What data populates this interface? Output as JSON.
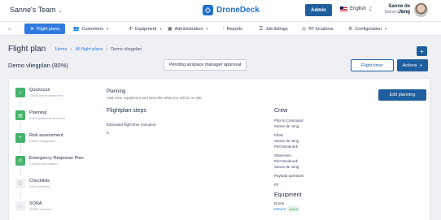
{
  "topbar": {
    "team": "Sanne's Team",
    "brand": "DroneDeck",
    "admin_label": "Admin",
    "language": "English",
    "user_name": "Sanne de Jong",
    "user_team": "Sanne's Team"
  },
  "nav": {
    "items": [
      {
        "label": "Flight plans",
        "icon": "send-icon"
      },
      {
        "label": "Customers",
        "icon": "users-icon"
      },
      {
        "label": "Equipment",
        "icon": "drone-icon"
      },
      {
        "label": "Administration",
        "icon": "briefcase-icon"
      },
      {
        "label": "Reports",
        "icon": "chart-icon"
      },
      {
        "label": "Job listings",
        "icon": "list-icon"
      },
      {
        "label": "RT locations",
        "icon": "target-icon"
      },
      {
        "label": "Configuration",
        "icon": "gear-icon"
      }
    ]
  },
  "header": {
    "title": "Flight plan",
    "breadcrumbs": [
      "Home",
      "All flight plans",
      "Demo vliegplan"
    ],
    "entity_title": "Demo vliegplan (80%)",
    "pending_label": "Pending airspace manager approval",
    "timer_label": "Flight timer",
    "actions_label": "Actions"
  },
  "steps": [
    {
      "title": "Quickscan",
      "subtitle": "Check the environment",
      "done": true
    },
    {
      "title": "Planning",
      "subtitle": "Add equipment and crew",
      "done": true
    },
    {
      "title": "Risk assessment",
      "subtitle": "Define mitigations",
      "done": true
    },
    {
      "title": "Emergency Response Plan",
      "subtitle": "Contact information",
      "done": true
    },
    {
      "title": "Checklists",
      "subtitle": "Add checklists",
      "done": false
    },
    {
      "title": "SORA",
      "subtitle": "SORA outcome",
      "done": false
    }
  ],
  "planning": {
    "title": "Planning",
    "subtitle": "Add crew, equipment and describe what you will do on site.",
    "edit_label": "Edit planning",
    "flight_steps_title": "Flightplan steps",
    "estimated_label": "Estimated flight time (minutes)",
    "estimated_value": "0"
  },
  "crew": {
    "title": "Crew",
    "pic_label": "Pilot in Command",
    "pic": [
      "Sanne de Jong"
    ],
    "pilots_label": "Pilots",
    "pilots": [
      "Sanne de Jong",
      "Piet Moobroek"
    ],
    "observers_label": "Observers",
    "observers": [
      "Piet Moobroek",
      "Sanne de Jong"
    ],
    "payload_label": "Payload operators",
    "rt_label": "RT"
  },
  "equipment": {
    "title": "Equipment",
    "drone_label": "Drone",
    "drone_name": "Mavic2",
    "drone_status": "Active"
  }
}
